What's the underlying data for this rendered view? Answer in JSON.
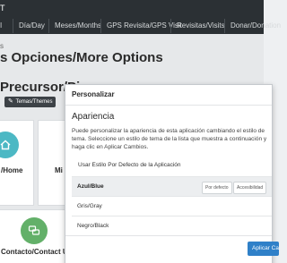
{
  "navbar": {
    "brand": "T",
    "tabs": [
      "I",
      "Día/Day",
      "Meses/Months",
      "GPS Revisita/GPS Visit",
      "Revisitas/Visits",
      "Donar/Donation"
    ]
  },
  "page": {
    "breadcrumb_fragment": "s",
    "title": "s Opciones/More Options",
    "section_title": "Precursor/Pi",
    "themes_button": "Temas/Themes"
  },
  "tiles": {
    "home": "/Home",
    "second": "Mi C",
    "contact": "Contacto/Contact Us"
  },
  "modal": {
    "title": "Personalizar",
    "subtitle": "Apariencia",
    "description": "Puede personalizar la apariencia de esta aplicación cambiando el estilo de tema. Seleccione un estilo de tema de la lista que muestra a continuación y haga clic en Aplicar Cambios.",
    "default_option": "Usar Estilo Por Defecto de la Aplicación",
    "themes": [
      {
        "label": "Azul/Blue",
        "selected": true
      },
      {
        "label": "Gris/Gray",
        "selected": false
      },
      {
        "label": "Negro/Black",
        "selected": false
      }
    ],
    "option_buttons": [
      "Por defecto",
      "Accesibilidad"
    ],
    "apply_button": "Aplicar Cambios"
  },
  "colors": {
    "navbar": "#2b3034",
    "home_tile_accent": "#4cb8c4",
    "contact_tile_accent": "#63b069",
    "primary_button": "#2f80c8"
  },
  "icons": {
    "themes_button_icon": "paint-icon",
    "home_tile_icon": "home-icon",
    "contact_tile_icon": "chat-icon"
  }
}
